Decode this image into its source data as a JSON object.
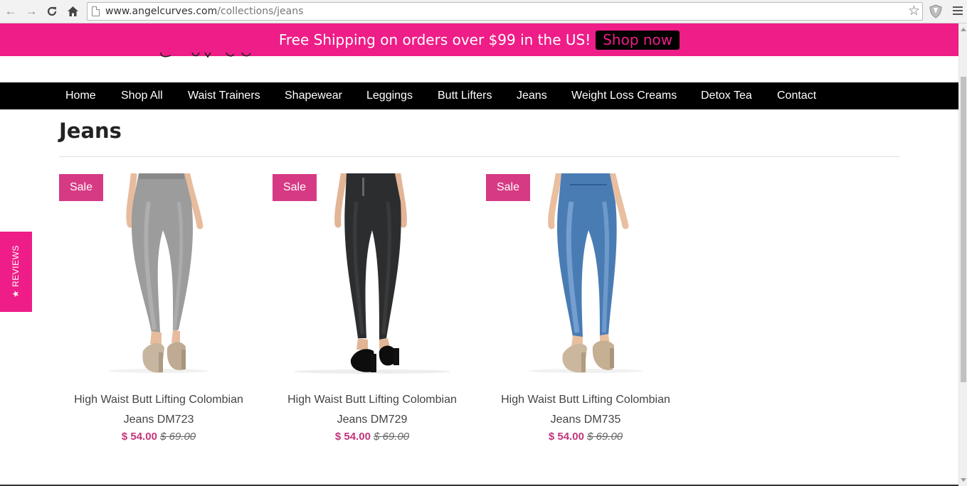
{
  "browser": {
    "url_host": "www.angelcurves.com",
    "url_path": "/collections/jeans"
  },
  "promo": {
    "text": "Free Shipping on orders over $99 in the US!",
    "button_label": "Shop now"
  },
  "nav": {
    "items": [
      "Home",
      "Shop All",
      "Waist Trainers",
      "Shapewear",
      "Leggings",
      "Butt Lifters",
      "Jeans",
      "Weight Loss Creams",
      "Detox Tea",
      "Contact"
    ]
  },
  "page": {
    "title": "Jeans"
  },
  "products": [
    {
      "badge": "Sale",
      "name_line1": "High Waist Butt Lifting Colombian",
      "name_line2": "Jeans DM723",
      "price": "$ 54.00",
      "compare_price": "$ 69.00"
    },
    {
      "badge": "Sale",
      "name_line1": "High Waist Butt Lifting Colombian",
      "name_line2": "Jeans DM729",
      "price": "$ 54.00",
      "compare_price": "$ 69.00"
    },
    {
      "badge": "Sale",
      "name_line1": "High Waist Butt Lifting Colombian",
      "name_line2": "Jeans DM735",
      "price": "$ 54.00",
      "compare_price": "$ 69.00"
    }
  ],
  "reviews_tab": {
    "label": "★ REVIEWS"
  },
  "colors": {
    "brand_pink": "#ee1d87",
    "sale_badge": "#d63a84",
    "price_sale": "#c2357b",
    "nav_bg": "#000000"
  }
}
